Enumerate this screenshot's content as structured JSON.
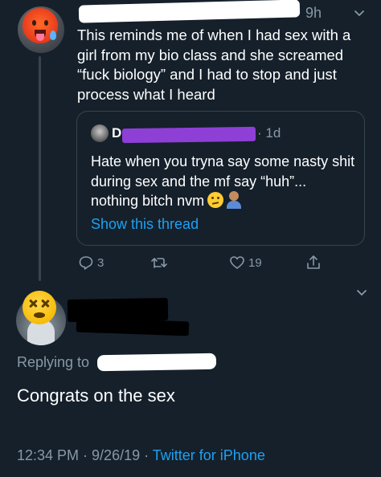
{
  "tweet": {
    "time": "9h",
    "text": "This reminds me of when I had sex with a girl from my bio class and she screamed “fuck biology” and I had to stop and just process what I heard"
  },
  "quote": {
    "author_initial": "D",
    "time": "· 1d",
    "text": "Hate when you tryna say some nasty shit during sex and the mf say “huh”... nothing bitch nvm",
    "link": "Show this thread"
  },
  "actions": {
    "reply_count": "3",
    "like_count": "19"
  },
  "reply": {
    "replying_to": "Replying to",
    "text": "Congrats on the sex",
    "timestamp": "12:34 PM · 9/26/19 ·",
    "source": "Twitter for iPhone"
  },
  "colors": {
    "background": "#15202b",
    "secondary_text": "#8899a6",
    "link": "#1da1f2",
    "border": "#38444d"
  },
  "icons": [
    "reply-icon",
    "retweet-icon",
    "like-icon",
    "share-icon",
    "chevron-down-icon"
  ]
}
